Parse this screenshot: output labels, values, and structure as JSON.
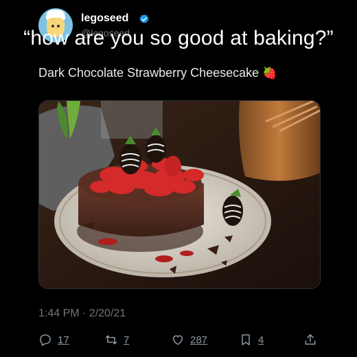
{
  "tweet": {
    "username": "legoseed",
    "handle": "@legoseed",
    "caption": "“how are you so good at baking?”",
    "text": "Dark Chocolate Strawberry Cheesecake",
    "emoji": "🍓",
    "timestamp": "1:44 PM · 2/20/21"
  },
  "actions": {
    "reply_count": "17",
    "retweet_count": "7",
    "like_count": "287",
    "bookmark_count": "4"
  },
  "colors": {
    "background": "#000000",
    "verified": "#1d9bf0",
    "secondary_text": "#6e767d"
  },
  "icons": [
    "reply-icon",
    "retweet-icon",
    "like-icon",
    "bookmark-icon",
    "share-icon",
    "verified-badge-icon",
    "strawberry-emoji"
  ]
}
